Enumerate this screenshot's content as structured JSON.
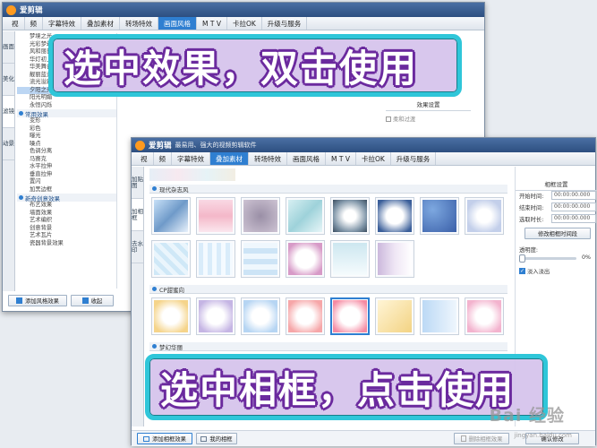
{
  "back_window": {
    "app_title": "爱剪辑",
    "menu": [
      "视",
      "频",
      "字幕特效",
      "叠加素材",
      "转场特效",
      "画面风格",
      "M T V",
      "卡拉OK",
      "升级与服务"
    ],
    "active_menu": 5,
    "side_tabs": [
      "画面",
      "美化",
      "滤镜",
      "动景"
    ],
    "list_items_top": [
      "梦境之光",
      "光彩梦幻",
      "风和丽日",
      "华灯初上",
      "华美舞台",
      "靓丽蓝光",
      "流光溢彩",
      "夕阳之光",
      "阳光明媚",
      "永恒闪烁"
    ],
    "selected_item": "夕阳之光",
    "category_1": "常用效果",
    "list_items_mid": [
      "变形",
      "彩色",
      "曝光",
      "噪点",
      "色调分离",
      "马赛克",
      "水平拉伸",
      "垂直拉伸",
      "置闪",
      "加黑边框"
    ],
    "category_2": "新奇创意效果",
    "list_items_bottom": [
      "布艺效果",
      "墙面效果",
      "艺术编织",
      "创意背景",
      "艺术瓦片",
      "瓷器背景效果"
    ],
    "panel_title": "效果设置",
    "checkbox_label": "柔和过渡",
    "add_button": "添加风格效果",
    "fav_button": "收起"
  },
  "front_window": {
    "app_title": "爱剪辑",
    "app_subtitle": "最易用、强大的视频剪辑软件",
    "menu": [
      "视",
      "频",
      "字幕特效",
      "叠加素材",
      "转场特效",
      "画面风格",
      "M T V",
      "卡拉OK",
      "升级与服务"
    ],
    "active_menu": 3,
    "side_tabs": [
      "加贴图",
      "加相框",
      "去水印"
    ],
    "sections": [
      "现代杂志风",
      "CP甜蜜向",
      "梦幻华丽"
    ],
    "settings": {
      "title": "相框设置",
      "start_label": "开始时间:",
      "start_value": "00:00:00.000",
      "end_label": "结束时间:",
      "end_value": "00:00:00.000",
      "duration_label": "选取时长:",
      "duration_value": "00:00:00.000",
      "modify_button": "修改相框时间段",
      "opacity_label": "透明度:",
      "opacity_value": "0%",
      "fade_label": "淡入淡出"
    },
    "add_button": "添加相框效果",
    "my_frames_button": "我的相框",
    "delete_button": "删除相框效果",
    "confirm_button": "确认修改"
  },
  "callout_top": "选中效果，双击使用",
  "callout_bottom": "选中相框，点击使用",
  "watermark": "Bai 经验",
  "watermark_url": "jingyan.baidu.com",
  "colors": {
    "accent": "#2f7fd1",
    "callout_border": "#2fc6d9",
    "callout_fill": "#d6c4ec",
    "callout_text_outline": "#6b2a9e"
  }
}
